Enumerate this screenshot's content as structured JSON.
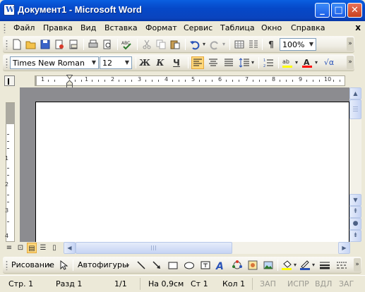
{
  "window": {
    "title": "Документ1 - Microsoft Word",
    "minimize_glyph": "_",
    "maximize_glyph": "□",
    "close_glyph": "✕"
  },
  "menu": {
    "items": [
      "Файл",
      "Правка",
      "Вид",
      "Вставка",
      "Формат",
      "Сервис",
      "Таблица",
      "Окно",
      "Справка"
    ],
    "close_doc_glyph": "x"
  },
  "standard_toolbar": {
    "zoom": "100%",
    "paragraph_mark": "¶"
  },
  "format_toolbar": {
    "font_name": "Times New Roman",
    "font_size": "12",
    "bold": "Ж",
    "italic": "К",
    "underline": "Ч",
    "font_color": "#FF0000",
    "highlight_color": "#FFFF00"
  },
  "ruler": {
    "numbers": [
      "1",
      "1",
      "2",
      "3",
      "4",
      "5",
      "6",
      "7",
      "8",
      "9",
      "10"
    ],
    "vertical_numbers": [
      "1",
      "2",
      "3",
      "4"
    ]
  },
  "drawing_toolbar": {
    "draw_menu": "Рисование",
    "autoshapes_menu": "Автофигуры"
  },
  "status_bar": {
    "page": "Стр. 1",
    "section": "Разд 1",
    "pages": "1/1",
    "position": "На 0,9см",
    "line": "Ст 1",
    "column": "Кол 1",
    "rec": "ЗАП",
    "trk": "ИСПР",
    "ext": "ВДЛ",
    "ovr": "ЗАГ"
  },
  "colors": {
    "titlebar": "#0A5FE0",
    "workspace": "#8C8C90",
    "chrome": "#ECE9D8"
  }
}
